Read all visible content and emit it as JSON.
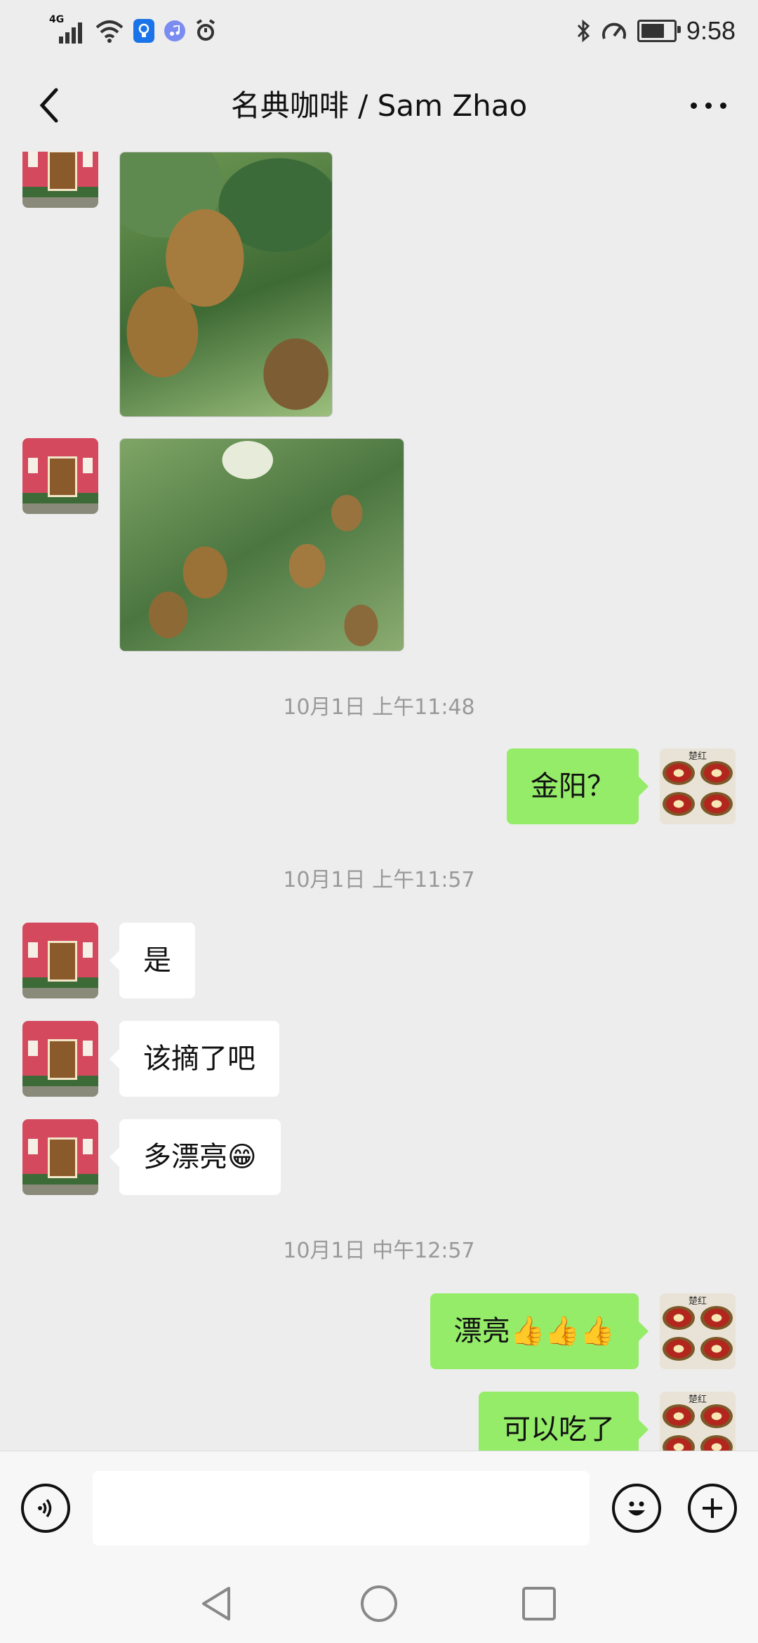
{
  "status_bar": {
    "network": "4G",
    "time": "9:58"
  },
  "header": {
    "title": "名典咖啡 / Sam Zhao"
  },
  "avatars": {
    "me_label": "楚红"
  },
  "chat": {
    "timestamps": [
      "10月1日 上午11:48",
      "10月1日 上午11:57",
      "10月1日 中午12:57"
    ],
    "messages": [
      {
        "side": "in",
        "type": "image",
        "subject": "kiwi-on-vine-closeup"
      },
      {
        "side": "in",
        "type": "image",
        "subject": "kiwi-cluster-on-vine"
      },
      {
        "side": "out",
        "type": "text",
        "text": "金阳？"
      },
      {
        "side": "in",
        "type": "text",
        "text": "是"
      },
      {
        "side": "in",
        "type": "text",
        "text": "该摘了吧"
      },
      {
        "side": "in",
        "type": "text",
        "text": "多漂亮😁"
      },
      {
        "side": "out",
        "type": "text",
        "text": "漂亮👍👍👍"
      },
      {
        "side": "out",
        "type": "text",
        "text": "可以吃了"
      }
    ]
  },
  "input_bar": {
    "text_value": ""
  },
  "colors": {
    "background": "#ededed",
    "outgoing_bubble": "#95ec69",
    "incoming_bubble": "#ffffff",
    "timestamp": "#999999"
  },
  "icons": [
    "signal-icon",
    "wifi-icon",
    "bulb-app-icon",
    "music-app-icon",
    "alarm-icon",
    "bluetooth-icon",
    "speed-icon",
    "battery-icon",
    "back-icon",
    "more-icon",
    "voice-icon",
    "emoji-icon",
    "plus-icon",
    "nav-back-icon",
    "nav-home-icon",
    "nav-recents-icon"
  ]
}
